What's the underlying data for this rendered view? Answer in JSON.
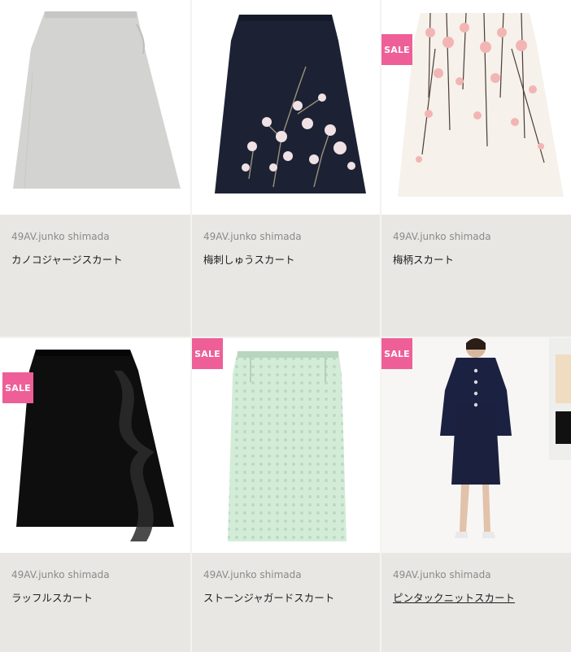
{
  "products": [
    {
      "brand": "49AV.junko shimada",
      "name": "カノコジャージスカート",
      "badge": "",
      "icon": "grey-a-line-skirt-photo",
      "underline": false
    },
    {
      "brand": "49AV.junko shimada",
      "name": "梅刺しゅうスカート",
      "badge": "",
      "icon": "navy-plum-embroidered-skirt-photo",
      "underline": false
    },
    {
      "brand": "49AV.junko shimada",
      "name": "梅柄スカート",
      "badge": "SALE",
      "icon": "plum-blossom-print-skirt-photo",
      "underline": false
    },
    {
      "brand": "49AV.junko shimada",
      "name": "ラッフルスカート",
      "badge": "SALE",
      "icon": "black-ruffle-skirt-photo",
      "underline": false
    },
    {
      "brand": "49AV.junko shimada",
      "name": "ストーンジャガードスカート",
      "badge": "SALE",
      "icon": "mint-jacquard-pencil-skirt-photo",
      "underline": false
    },
    {
      "brand": "49AV.junko shimada",
      "name": "ピンタックニットスカート",
      "badge": "SALE",
      "icon": "model-navy-suit-photo",
      "underline": true
    }
  ],
  "colors": {
    "background": "#e9e7e3",
    "sale_badge": "#ee5f98",
    "brand_text": "#8a8a8a",
    "name_text": "#1f1f1f"
  }
}
